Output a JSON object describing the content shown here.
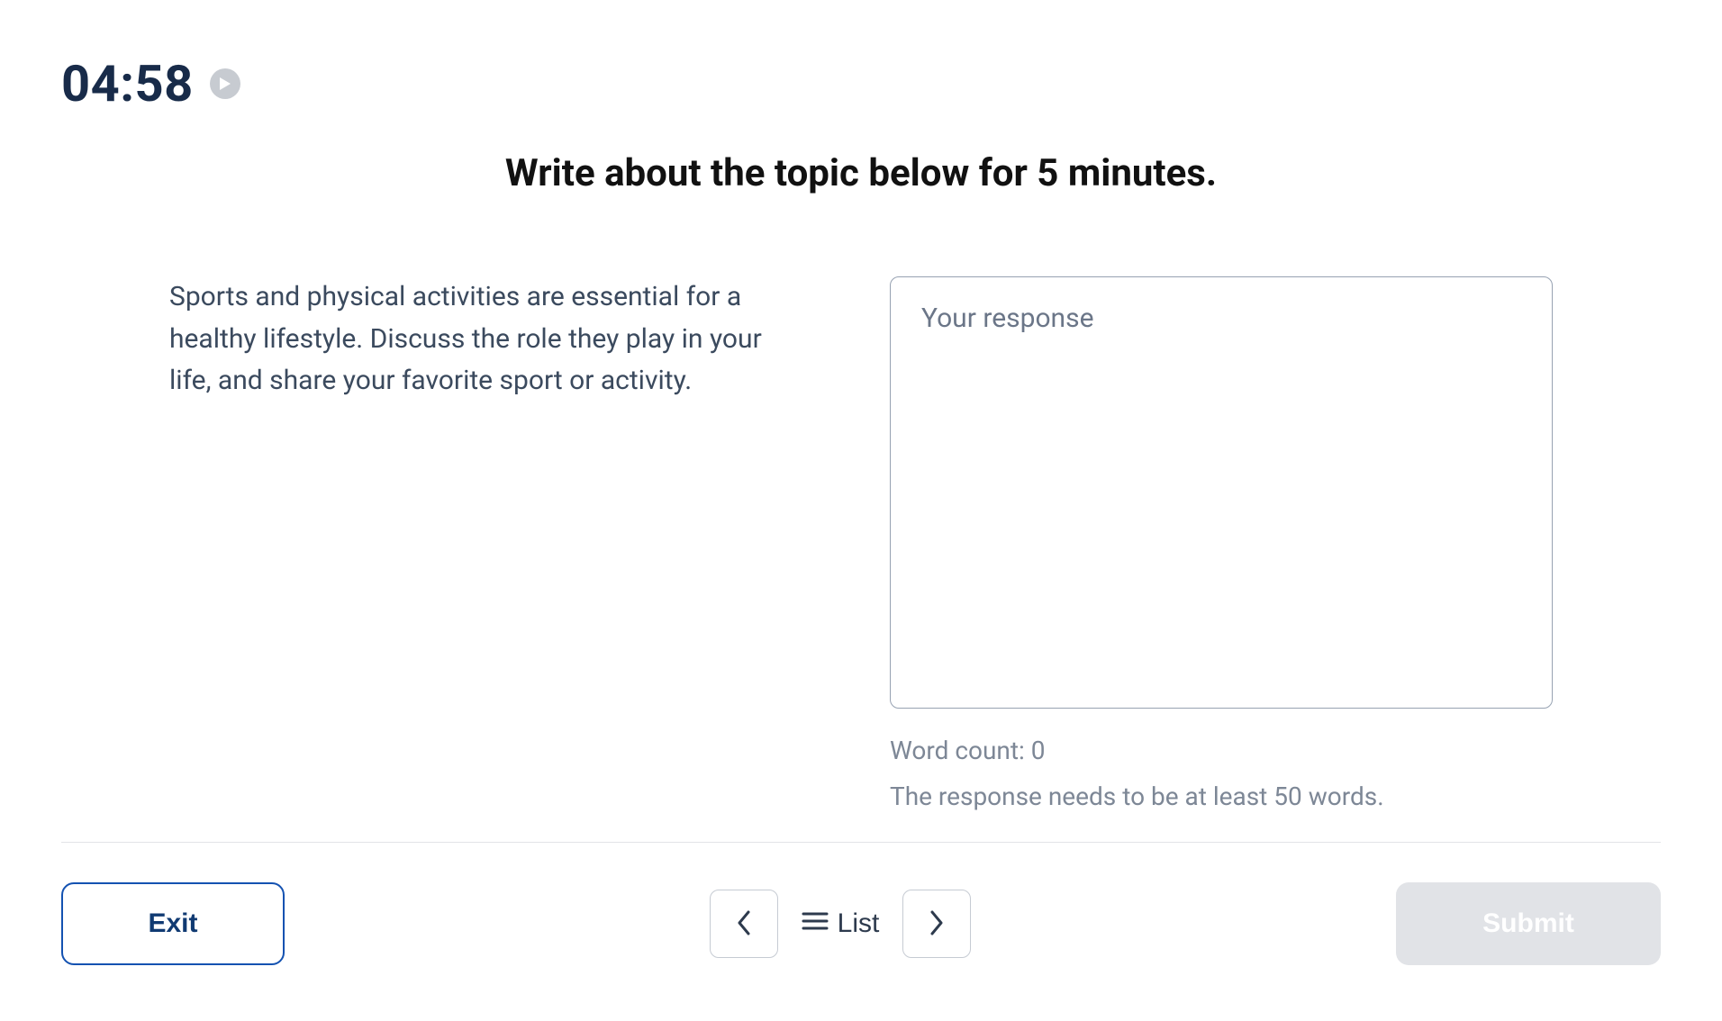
{
  "timer": "04:58",
  "heading": "Write about the topic below for 5 minutes.",
  "prompt_text": "Sports and physical activities are essential for a healthy lifestyle. Discuss the role they play in your life, and share your favorite sport or activity.",
  "response": {
    "placeholder": "Your response",
    "value": ""
  },
  "word_count_text": "Word count: 0",
  "min_words_text": "The response needs to be at least 50 words.",
  "footer": {
    "exit_label": "Exit",
    "list_label": "List",
    "submit_label": "Submit"
  }
}
